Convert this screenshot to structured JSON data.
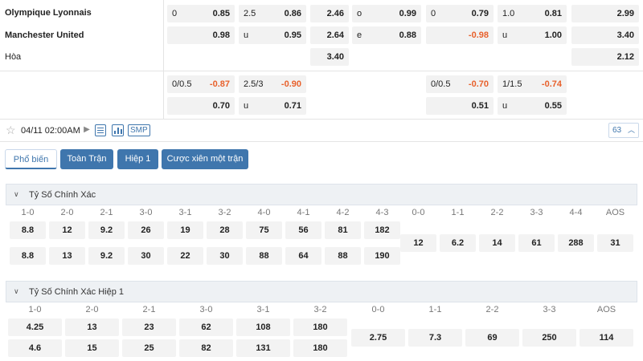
{
  "teams": {
    "home": "Olympique Lyonnais",
    "away": "Manchester United",
    "draw": "Hòa"
  },
  "full": {
    "hc": [
      [
        "0",
        "0.85"
      ],
      [
        "",
        "0.98"
      ]
    ],
    "ou": [
      [
        "2.5",
        "0.86"
      ],
      [
        "u",
        "0.95"
      ]
    ],
    "x12": [
      "2.46",
      "2.64",
      "3.40"
    ],
    "oe": [
      [
        "o",
        "0.99"
      ],
      [
        "e",
        "0.88"
      ]
    ]
  },
  "first": {
    "hc": [
      [
        "0",
        "0.79"
      ],
      [
        "",
        "-0.98"
      ]
    ],
    "ou": [
      [
        "1.0",
        "0.81"
      ],
      [
        "u",
        "1.00"
      ]
    ],
    "x12": [
      "2.99",
      "3.40",
      "2.12"
    ]
  },
  "alt_full": {
    "hc": [
      [
        "0/0.5",
        "-0.87"
      ],
      [
        "",
        "0.70"
      ]
    ],
    "ou": [
      [
        "2.5/3",
        "-0.90"
      ],
      [
        "u",
        "0.71"
      ]
    ]
  },
  "alt_first": {
    "hc": [
      [
        "0/0.5",
        "-0.70"
      ],
      [
        "",
        "0.51"
      ]
    ],
    "ou": [
      [
        "1/1.5",
        "-0.74"
      ],
      [
        "u",
        "0.55"
      ]
    ]
  },
  "match": {
    "date": "04/11 02:00AM",
    "smp": "SMP",
    "count": "63"
  },
  "tabs": [
    "Phổ biến",
    "Toàn Trận",
    "Hiệp 1",
    "Cược xiên một trận"
  ],
  "section1": {
    "title": "Tỷ Số Chính Xác",
    "home_scores": [
      "1-0",
      "2-0",
      "2-1",
      "3-0",
      "3-1",
      "3-2",
      "4-0",
      "4-1",
      "4-2",
      "4-3"
    ],
    "home_odds": [
      "8.8",
      "12",
      "9.2",
      "26",
      "19",
      "28",
      "75",
      "56",
      "81",
      "182"
    ],
    "away_odds": [
      "8.8",
      "13",
      "9.2",
      "30",
      "22",
      "30",
      "88",
      "64",
      "88",
      "190"
    ],
    "draw_scores": [
      "0-0",
      "1-1",
      "2-2",
      "3-3",
      "4-4",
      "AOS"
    ],
    "draw_odds": [
      "12",
      "6.2",
      "14",
      "61",
      "288",
      "31"
    ]
  },
  "section2": {
    "title": "Tỷ Số Chính Xác Hiệp 1",
    "home_scores": [
      "1-0",
      "2-0",
      "2-1",
      "3-0",
      "3-1",
      "3-2"
    ],
    "home_odds": [
      "4.25",
      "13",
      "23",
      "62",
      "108",
      "180"
    ],
    "away_odds": [
      "4.6",
      "15",
      "25",
      "82",
      "131",
      "180"
    ],
    "draw_scores": [
      "0-0",
      "1-1",
      "2-2",
      "3-3",
      "AOS"
    ],
    "draw_odds": [
      "2.75",
      "7.3",
      "69",
      "250",
      "114"
    ]
  },
  "colors": {
    "accent": "#3f76ad",
    "negative": "#e8612c"
  }
}
